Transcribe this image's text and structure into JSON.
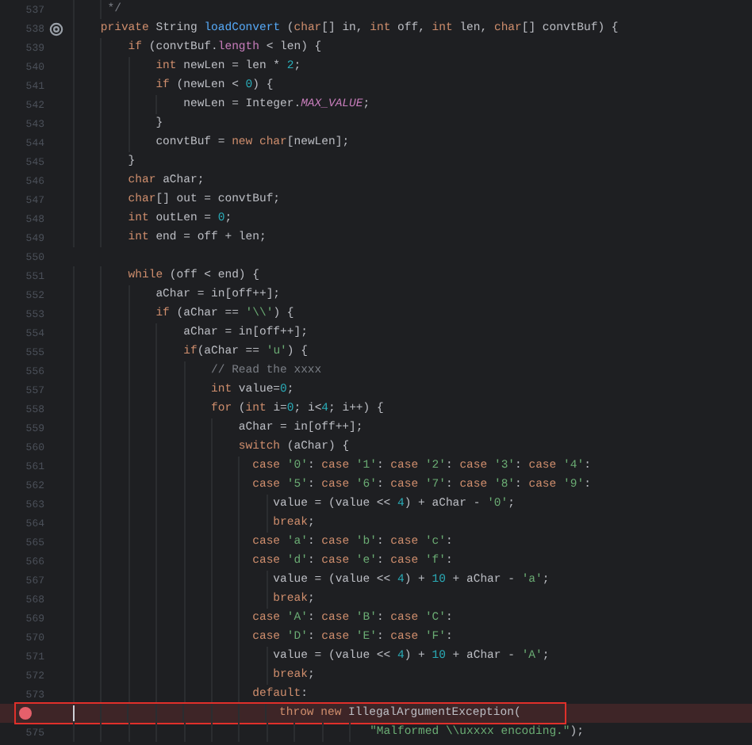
{
  "lines": [
    {
      "number": "537",
      "kind": "normal",
      "tokens": [
        {
          "text": "     */",
          "kind": "comment"
        }
      ]
    },
    {
      "number": "538",
      "kind": "override",
      "tokens": [
        {
          "text": "    private ",
          "kind": "keyword"
        },
        {
          "text": "String ",
          "kind": "plain"
        },
        {
          "text": "loadConvert",
          "kind": "method"
        },
        {
          "text": " (",
          "kind": "plain"
        },
        {
          "text": "char",
          "kind": "keyword"
        },
        {
          "text": "[] in, ",
          "kind": "plain"
        },
        {
          "text": "int",
          "kind": "keyword"
        },
        {
          "text": " off, ",
          "kind": "plain"
        },
        {
          "text": "int",
          "kind": "keyword"
        },
        {
          "text": " len, ",
          "kind": "plain"
        },
        {
          "text": "char",
          "kind": "keyword"
        },
        {
          "text": "[] convtBuf) {",
          "kind": "plain"
        }
      ]
    },
    {
      "number": "539",
      "kind": "normal",
      "tokens": [
        {
          "text": "        if",
          "kind": "keyword"
        },
        {
          "text": " (convtBuf.",
          "kind": "plain"
        },
        {
          "text": "length",
          "kind": "field"
        },
        {
          "text": " < len) {",
          "kind": "plain"
        }
      ]
    },
    {
      "number": "540",
      "kind": "normal",
      "tokens": [
        {
          "text": "            int",
          "kind": "keyword"
        },
        {
          "text": " newLen = len * ",
          "kind": "plain"
        },
        {
          "text": "2",
          "kind": "number"
        },
        {
          "text": ";",
          "kind": "plain"
        }
      ]
    },
    {
      "number": "541",
      "kind": "normal",
      "tokens": [
        {
          "text": "            if",
          "kind": "keyword"
        },
        {
          "text": " (newLen < ",
          "kind": "plain"
        },
        {
          "text": "0",
          "kind": "number"
        },
        {
          "text": ") {",
          "kind": "plain"
        }
      ]
    },
    {
      "number": "542",
      "kind": "normal",
      "tokens": [
        {
          "text": "                newLen = Integer.",
          "kind": "plain"
        },
        {
          "text": "MAX_VALUE",
          "kind": "constant"
        },
        {
          "text": ";",
          "kind": "plain"
        }
      ]
    },
    {
      "number": "543",
      "kind": "normal",
      "tokens": [
        {
          "text": "            }",
          "kind": "plain"
        }
      ]
    },
    {
      "number": "544",
      "kind": "normal",
      "tokens": [
        {
          "text": "            convtBuf = ",
          "kind": "plain"
        },
        {
          "text": "new char",
          "kind": "keyword"
        },
        {
          "text": "[newLen];",
          "kind": "plain"
        }
      ]
    },
    {
      "number": "545",
      "kind": "normal",
      "tokens": [
        {
          "text": "        }",
          "kind": "plain"
        }
      ]
    },
    {
      "number": "546",
      "kind": "normal",
      "tokens": [
        {
          "text": "        char",
          "kind": "keyword"
        },
        {
          "text": " aChar;",
          "kind": "plain"
        }
      ]
    },
    {
      "number": "547",
      "kind": "normal",
      "tokens": [
        {
          "text": "        char",
          "kind": "keyword"
        },
        {
          "text": "[] out = convtBuf;",
          "kind": "plain"
        }
      ]
    },
    {
      "number": "548",
      "kind": "normal",
      "tokens": [
        {
          "text": "        int",
          "kind": "keyword"
        },
        {
          "text": " outLen = ",
          "kind": "plain"
        },
        {
          "text": "0",
          "kind": "number"
        },
        {
          "text": ";",
          "kind": "plain"
        }
      ]
    },
    {
      "number": "549",
      "kind": "normal",
      "tokens": [
        {
          "text": "        int",
          "kind": "keyword"
        },
        {
          "text": " end = off + len;",
          "kind": "plain"
        }
      ]
    },
    {
      "number": "550",
      "kind": "normal"
    },
    {
      "number": "551",
      "kind": "normal",
      "tokens": [
        {
          "text": "        while",
          "kind": "keyword"
        },
        {
          "text": " (off < end) {",
          "kind": "plain"
        }
      ]
    },
    {
      "number": "552",
      "kind": "normal",
      "tokens": [
        {
          "text": "            aChar = in[off++];",
          "kind": "plain"
        }
      ]
    },
    {
      "number": "553",
      "kind": "normal",
      "tokens": [
        {
          "text": "            if",
          "kind": "keyword"
        },
        {
          "text": " (aChar == ",
          "kind": "plain"
        },
        {
          "text": "'\\\\'",
          "kind": "string"
        },
        {
          "text": ") {",
          "kind": "plain"
        }
      ]
    },
    {
      "number": "554",
      "kind": "normal",
      "tokens": [
        {
          "text": "                aChar = in[off++];",
          "kind": "plain"
        }
      ]
    },
    {
      "number": "555",
      "kind": "normal",
      "tokens": [
        {
          "text": "                if",
          "kind": "keyword"
        },
        {
          "text": "(aChar == ",
          "kind": "plain"
        },
        {
          "text": "'u'",
          "kind": "string"
        },
        {
          "text": ") {",
          "kind": "plain"
        }
      ]
    },
    {
      "number": "556",
      "kind": "normal",
      "tokens": [
        {
          "text": "                    // Read the xxxx",
          "kind": "comment"
        }
      ]
    },
    {
      "number": "557",
      "kind": "normal",
      "tokens": [
        {
          "text": "                    int",
          "kind": "keyword"
        },
        {
          "text": " value=",
          "kind": "plain"
        },
        {
          "text": "0",
          "kind": "number"
        },
        {
          "text": ";",
          "kind": "plain"
        }
      ]
    },
    {
      "number": "558",
      "kind": "normal",
      "tokens": [
        {
          "text": "                    for",
          "kind": "keyword"
        },
        {
          "text": " (",
          "kind": "plain"
        },
        {
          "text": "int",
          "kind": "keyword"
        },
        {
          "text": " i=",
          "kind": "plain"
        },
        {
          "text": "0",
          "kind": "number"
        },
        {
          "text": "; i<",
          "kind": "plain"
        },
        {
          "text": "4",
          "kind": "number"
        },
        {
          "text": "; i++) {",
          "kind": "plain"
        }
      ]
    },
    {
      "number": "559",
      "kind": "normal",
      "tokens": [
        {
          "text": "                        aChar = in[off++];",
          "kind": "plain"
        }
      ]
    },
    {
      "number": "560",
      "kind": "normal",
      "tokens": [
        {
          "text": "                        switch",
          "kind": "keyword"
        },
        {
          "text": " (aChar) {",
          "kind": "plain"
        }
      ]
    },
    {
      "number": "561",
      "kind": "normal",
      "tokens": [
        {
          "text": "                          case ",
          "kind": "keyword"
        },
        {
          "text": "'0'",
          "kind": "string"
        },
        {
          "text": ": ",
          "kind": "plain"
        },
        {
          "text": "case ",
          "kind": "keyword"
        },
        {
          "text": "'1'",
          "kind": "string"
        },
        {
          "text": ": ",
          "kind": "plain"
        },
        {
          "text": "case ",
          "kind": "keyword"
        },
        {
          "text": "'2'",
          "kind": "string"
        },
        {
          "text": ": ",
          "kind": "plain"
        },
        {
          "text": "case ",
          "kind": "keyword"
        },
        {
          "text": "'3'",
          "kind": "string"
        },
        {
          "text": ": ",
          "kind": "plain"
        },
        {
          "text": "case ",
          "kind": "keyword"
        },
        {
          "text": "'4'",
          "kind": "string"
        },
        {
          "text": ":",
          "kind": "plain"
        }
      ]
    },
    {
      "number": "562",
      "kind": "normal",
      "tokens": [
        {
          "text": "                          case ",
          "kind": "keyword"
        },
        {
          "text": "'5'",
          "kind": "string"
        },
        {
          "text": ": ",
          "kind": "plain"
        },
        {
          "text": "case ",
          "kind": "keyword"
        },
        {
          "text": "'6'",
          "kind": "string"
        },
        {
          "text": ": ",
          "kind": "plain"
        },
        {
          "text": "case ",
          "kind": "keyword"
        },
        {
          "text": "'7'",
          "kind": "string"
        },
        {
          "text": ": ",
          "kind": "plain"
        },
        {
          "text": "case ",
          "kind": "keyword"
        },
        {
          "text": "'8'",
          "kind": "string"
        },
        {
          "text": ": ",
          "kind": "plain"
        },
        {
          "text": "case ",
          "kind": "keyword"
        },
        {
          "text": "'9'",
          "kind": "string"
        },
        {
          "text": ":",
          "kind": "plain"
        }
      ]
    },
    {
      "number": "563",
      "kind": "normal",
      "tokens": [
        {
          "text": "                             value = (value << ",
          "kind": "plain"
        },
        {
          "text": "4",
          "kind": "number"
        },
        {
          "text": ") + aChar - ",
          "kind": "plain"
        },
        {
          "text": "'0'",
          "kind": "string"
        },
        {
          "text": ";",
          "kind": "plain"
        }
      ]
    },
    {
      "number": "564",
      "kind": "normal",
      "tokens": [
        {
          "text": "                             break",
          "kind": "keyword"
        },
        {
          "text": ";",
          "kind": "plain"
        }
      ]
    },
    {
      "number": "565",
      "kind": "normal",
      "tokens": [
        {
          "text": "                          case ",
          "kind": "keyword"
        },
        {
          "text": "'a'",
          "kind": "string"
        },
        {
          "text": ": ",
          "kind": "plain"
        },
        {
          "text": "case ",
          "kind": "keyword"
        },
        {
          "text": "'b'",
          "kind": "string"
        },
        {
          "text": ": ",
          "kind": "plain"
        },
        {
          "text": "case ",
          "kind": "keyword"
        },
        {
          "text": "'c'",
          "kind": "string"
        },
        {
          "text": ":",
          "kind": "plain"
        }
      ]
    },
    {
      "number": "566",
      "kind": "normal",
      "tokens": [
        {
          "text": "                          case ",
          "kind": "keyword"
        },
        {
          "text": "'d'",
          "kind": "string"
        },
        {
          "text": ": ",
          "kind": "plain"
        },
        {
          "text": "case ",
          "kind": "keyword"
        },
        {
          "text": "'e'",
          "kind": "string"
        },
        {
          "text": ": ",
          "kind": "plain"
        },
        {
          "text": "case ",
          "kind": "keyword"
        },
        {
          "text": "'f'",
          "kind": "string"
        },
        {
          "text": ":",
          "kind": "plain"
        }
      ]
    },
    {
      "number": "567",
      "kind": "normal",
      "tokens": [
        {
          "text": "                             value = (value << ",
          "kind": "plain"
        },
        {
          "text": "4",
          "kind": "number"
        },
        {
          "text": ") + ",
          "kind": "plain"
        },
        {
          "text": "10",
          "kind": "number"
        },
        {
          "text": " + aChar - ",
          "kind": "plain"
        },
        {
          "text": "'a'",
          "kind": "string"
        },
        {
          "text": ";",
          "kind": "plain"
        }
      ]
    },
    {
      "number": "568",
      "kind": "normal",
      "tokens": [
        {
          "text": "                             break",
          "kind": "keyword"
        },
        {
          "text": ";",
          "kind": "plain"
        }
      ]
    },
    {
      "number": "569",
      "kind": "normal",
      "tokens": [
        {
          "text": "                          case ",
          "kind": "keyword"
        },
        {
          "text": "'A'",
          "kind": "string"
        },
        {
          "text": ": ",
          "kind": "plain"
        },
        {
          "text": "case ",
          "kind": "keyword"
        },
        {
          "text": "'B'",
          "kind": "string"
        },
        {
          "text": ": ",
          "kind": "plain"
        },
        {
          "text": "case ",
          "kind": "keyword"
        },
        {
          "text": "'C'",
          "kind": "string"
        },
        {
          "text": ":",
          "kind": "plain"
        }
      ]
    },
    {
      "number": "570",
      "kind": "normal",
      "tokens": [
        {
          "text": "                          case ",
          "kind": "keyword"
        },
        {
          "text": "'D'",
          "kind": "string"
        },
        {
          "text": ": ",
          "kind": "plain"
        },
        {
          "text": "case ",
          "kind": "keyword"
        },
        {
          "text": "'E'",
          "kind": "string"
        },
        {
          "text": ": ",
          "kind": "plain"
        },
        {
          "text": "case ",
          "kind": "keyword"
        },
        {
          "text": "'F'",
          "kind": "string"
        },
        {
          "text": ":",
          "kind": "plain"
        }
      ]
    },
    {
      "number": "571",
      "kind": "normal",
      "tokens": [
        {
          "text": "                             value = (value << ",
          "kind": "plain"
        },
        {
          "text": "4",
          "kind": "number"
        },
        {
          "text": ") + ",
          "kind": "plain"
        },
        {
          "text": "10",
          "kind": "number"
        },
        {
          "text": " + aChar - ",
          "kind": "plain"
        },
        {
          "text": "'A'",
          "kind": "string"
        },
        {
          "text": ";",
          "kind": "plain"
        }
      ]
    },
    {
      "number": "572",
      "kind": "normal",
      "tokens": [
        {
          "text": "                             break",
          "kind": "keyword"
        },
        {
          "text": ";",
          "kind": "plain"
        }
      ]
    },
    {
      "number": "573",
      "kind": "normal",
      "tokens": [
        {
          "text": "                          default",
          "kind": "keyword"
        },
        {
          "text": ":",
          "kind": "plain"
        }
      ]
    },
    {
      "kind": "breakpoint",
      "caret": true,
      "tokens": [
        {
          "text": "                              throw new",
          "kind": "keyword"
        },
        {
          "text": " IllegalArgumentException(",
          "kind": "plain"
        }
      ]
    },
    {
      "number": "575",
      "kind": "normal",
      "tokens": [
        {
          "text": "                                           \"Malformed \\\\uxxxx encoding.\"",
          "kind": "string"
        },
        {
          "text": ");",
          "kind": "plain"
        }
      ]
    }
  ]
}
